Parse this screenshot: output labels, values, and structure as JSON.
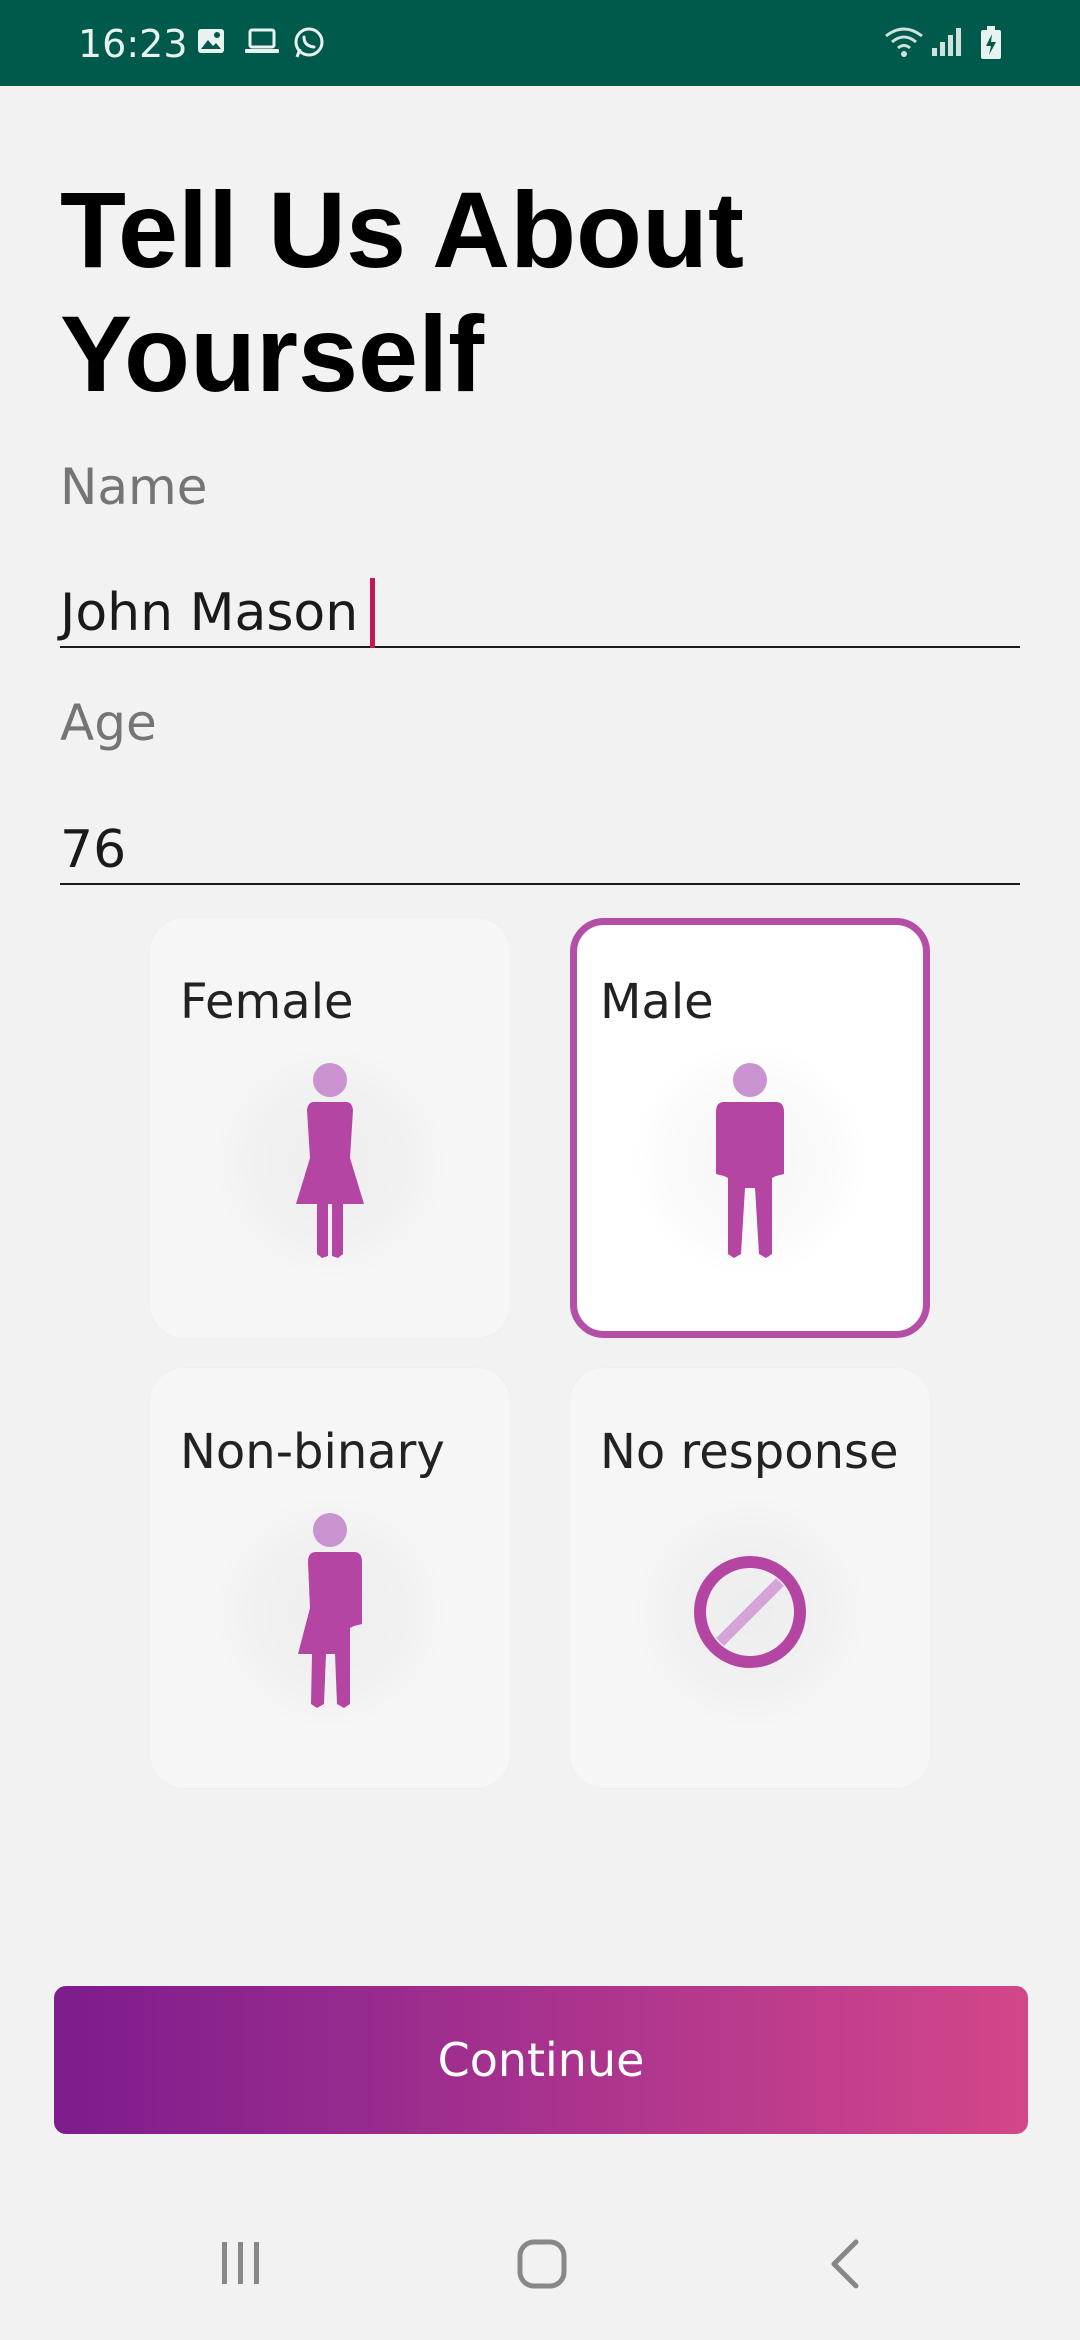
{
  "status_bar": {
    "time": "16:23",
    "left_icons": [
      "image-icon",
      "laptop-icon",
      "whatsapp-icon"
    ],
    "right_icons": [
      "wifi-icon",
      "signal-icon",
      "battery-charging-icon"
    ],
    "background": "#005a4b"
  },
  "page": {
    "title": "Tell Us About Yourself"
  },
  "form": {
    "name": {
      "label": "Name",
      "value": "John Mason"
    },
    "age": {
      "label": "Age",
      "value": "76"
    }
  },
  "gender_options": [
    {
      "label": "Female",
      "icon": "female-figure-icon",
      "selected": false
    },
    {
      "label": "Male",
      "icon": "male-figure-icon",
      "selected": true
    },
    {
      "label": "Non-binary",
      "icon": "non-binary-figure-icon",
      "selected": false
    },
    {
      "label": "No response",
      "icon": "no-response-icon",
      "selected": false
    }
  ],
  "accent_color": "#b44fa8",
  "continue_button": {
    "label": "Continue"
  },
  "nav_bar": {
    "icons": [
      "recent-apps-icon",
      "home-icon",
      "back-icon"
    ]
  }
}
